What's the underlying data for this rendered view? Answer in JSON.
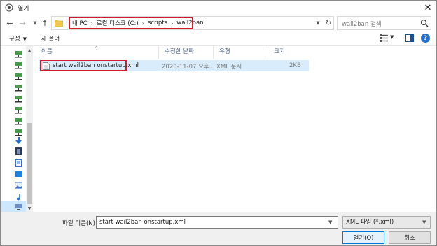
{
  "window": {
    "title": "열기"
  },
  "nav": {
    "back_icon": "arrow-left-icon",
    "forward_icon": "arrow-right-icon",
    "recent_icon": "chevron-down-icon",
    "up_icon": "arrow-up-icon"
  },
  "address": {
    "crumbs": [
      "내 PC",
      "로컬 디스크 (C:)",
      "scripts",
      "wail2ban"
    ],
    "separator": "›"
  },
  "search": {
    "placeholder": "wail2ban 검색"
  },
  "toolbar": {
    "organize": "구성",
    "new_folder": "새 폴더"
  },
  "columns": {
    "name": "이름",
    "date": "수정한 날짜",
    "type": "유형",
    "size": "크기"
  },
  "files": [
    {
      "name": "start wail2ban onstartup.xml",
      "date": "2020-11-07 오후...",
      "type": "XML 문서",
      "size": "2KB"
    }
  ],
  "bottom": {
    "filename_label": "파일 이름(N):",
    "filename_value": "start wail2ban onstartup.xml",
    "filter_value": "XML 파일 (*.xml)",
    "open_label": "열기(O)",
    "cancel_label": "취소"
  },
  "colors": {
    "highlight_box": "#d11a2a",
    "selection": "#d9ecfb",
    "accent": "#0078d7"
  }
}
